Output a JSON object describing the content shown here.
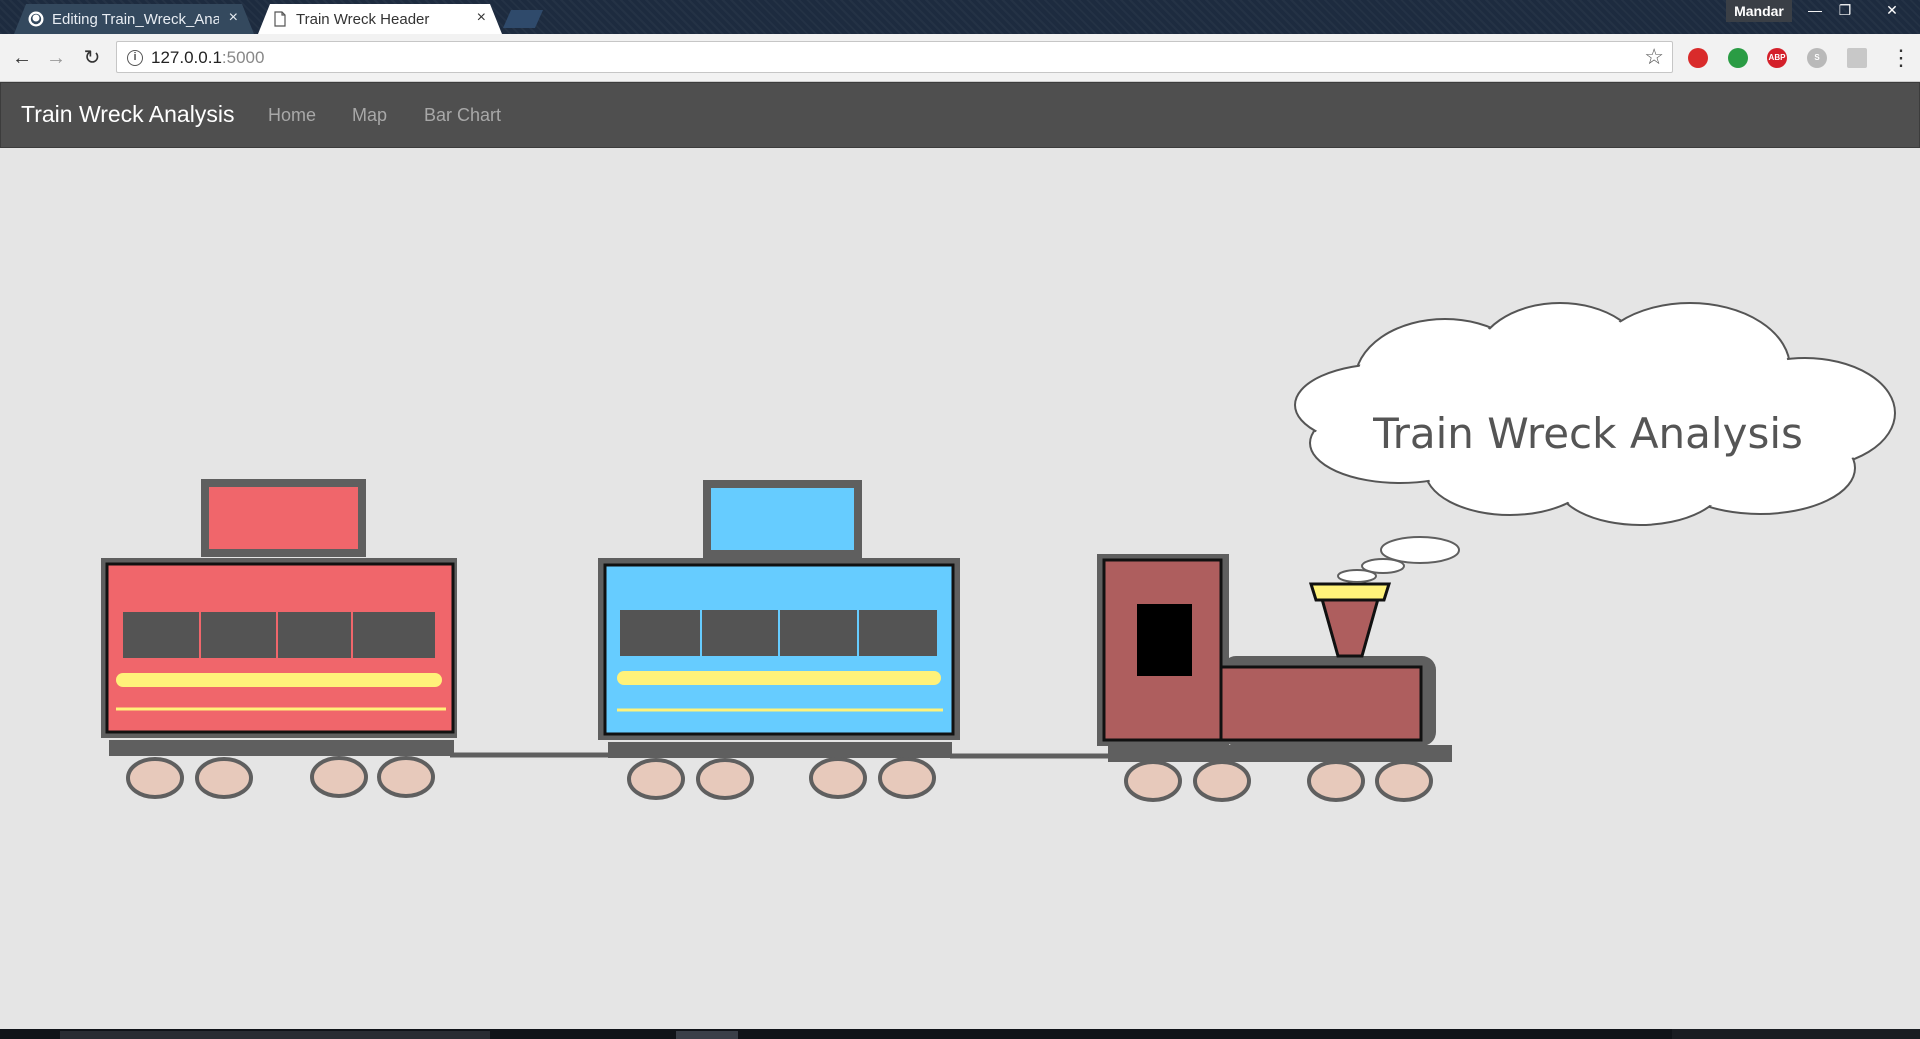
{
  "browser": {
    "tabs": [
      {
        "title": "Editing Train_Wreck_Analysis",
        "active": false,
        "icon": "github-icon"
      },
      {
        "title": "Train Wreck Header",
        "active": true,
        "icon": "page-icon"
      }
    ],
    "close_glyph": "×",
    "profile_name": "Mandar",
    "window_buttons": {
      "minimize": "—",
      "maximize": "❐",
      "close": "✕"
    },
    "url_host": "127.0.0.1",
    "url_port": ":5000",
    "nav": {
      "back": "←",
      "forward": "→",
      "reload": "↻"
    },
    "star": "☆",
    "menu": "⋮",
    "extensions": [
      {
        "name": "opera-shield-icon",
        "label": "",
        "color": "#d92b2b"
      },
      {
        "name": "adguard-icon",
        "label": "",
        "color": "#2a9c44"
      },
      {
        "name": "abp-icon",
        "label": "ABP",
        "color": "#d4202a"
      },
      {
        "name": "skype-icon",
        "label": "S",
        "color": "#b9b9b9"
      },
      {
        "name": "pdf-icon",
        "label": "",
        "color": "#c8c8c8"
      }
    ]
  },
  "navbar": {
    "brand": "Train Wreck Analysis",
    "links": [
      "Home",
      "Map",
      "Bar Chart"
    ]
  },
  "scene": {
    "cloud_text": "Train Wreck Analysis",
    "colors": {
      "car1": "#f0666b",
      "car2": "#66ccff",
      "engine": "#ae5e5e",
      "frame": "#5f5f5f",
      "wheel": "#e7c9bb",
      "stripe": "#fff27a",
      "window": "#545454"
    }
  }
}
